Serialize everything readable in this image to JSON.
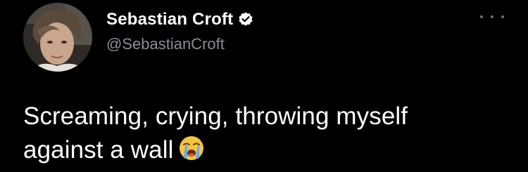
{
  "tweet": {
    "author": {
      "display_name": "Sebastian Croft",
      "handle": "@SebastianCroft",
      "verified": true
    },
    "text_line_1": "Screaming, crying, throwing myself",
    "text_line_2": "against a wall",
    "emoji": "loudly-crying-face-emoji",
    "menu_icon": "more-options-icon"
  },
  "colors": {
    "background": "#000000",
    "text_primary": "#ffffff",
    "text_secondary": "#8b8f94",
    "verified_badge": "#ffffff"
  }
}
